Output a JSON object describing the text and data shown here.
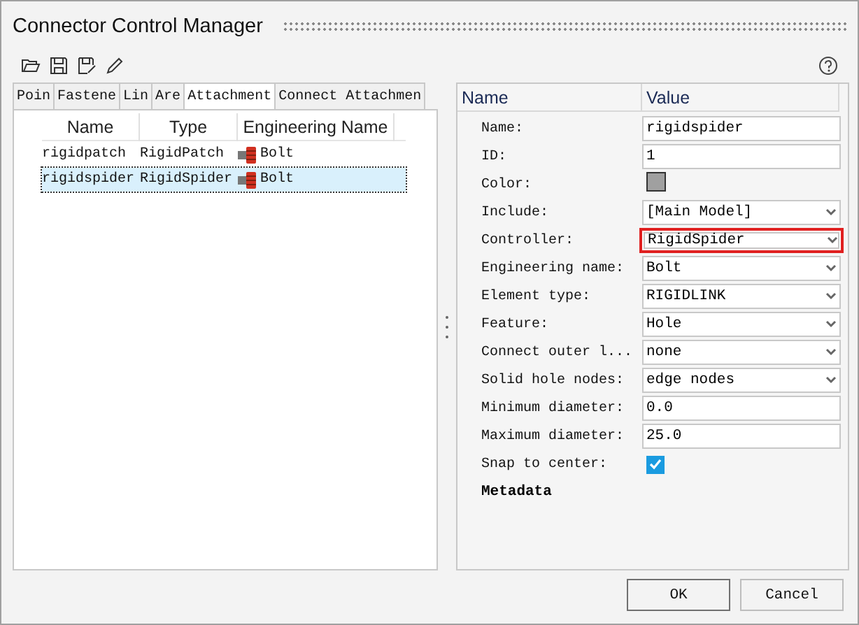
{
  "window": {
    "title": "Connector Control Manager"
  },
  "tabs": [
    {
      "label": "Poin",
      "selected": false
    },
    {
      "label": "Fastene",
      "selected": false
    },
    {
      "label": "Lin",
      "selected": false
    },
    {
      "label": "Are",
      "selected": false
    },
    {
      "label": "Attachment",
      "selected": true
    },
    {
      "label": "Connect Attachmen",
      "selected": false
    }
  ],
  "list": {
    "columns": [
      "Name",
      "Type",
      "Engineering Name"
    ],
    "rows": [
      {
        "name": "rigidpatch",
        "type": "RigidPatch",
        "engineering_name": "Bolt",
        "selected": false
      },
      {
        "name": "rigidspider",
        "type": "RigidSpider",
        "engineering_name": "Bolt",
        "selected": true
      }
    ]
  },
  "properties": {
    "columns": [
      "Name",
      "Value"
    ],
    "rows": [
      {
        "kind": "text",
        "label": "Name:",
        "value": "rigidspider"
      },
      {
        "kind": "text",
        "label": "ID:",
        "value": "1"
      },
      {
        "kind": "color",
        "label": "Color:",
        "color": "#a0a0a0"
      },
      {
        "kind": "select",
        "label": "Include:",
        "value": "[Main Model]",
        "highlighted": false
      },
      {
        "kind": "select",
        "label": "Controller:",
        "value": "RigidSpider",
        "highlighted": true
      },
      {
        "kind": "select",
        "label": "Engineering name:",
        "value": "Bolt",
        "highlighted": false
      },
      {
        "kind": "select",
        "label": "Element type:",
        "value": "RIGIDLINK",
        "highlighted": false
      },
      {
        "kind": "select",
        "label": "Feature:",
        "value": "Hole",
        "highlighted": false
      },
      {
        "kind": "select",
        "label": "Connect outer l...",
        "value": "none",
        "highlighted": false
      },
      {
        "kind": "select",
        "label": "Solid hole nodes:",
        "value": "edge nodes",
        "highlighted": false
      },
      {
        "kind": "text",
        "label": "Minimum diameter:",
        "value": "0.0"
      },
      {
        "kind": "text",
        "label": "Maximum diameter:",
        "value": "25.0"
      },
      {
        "kind": "checkbox",
        "label": "Snap to center:",
        "checked": true
      }
    ],
    "section": "Metadata"
  },
  "buttons": [
    {
      "label": "OK",
      "default": true
    },
    {
      "label": "Cancel",
      "default": false
    }
  ]
}
